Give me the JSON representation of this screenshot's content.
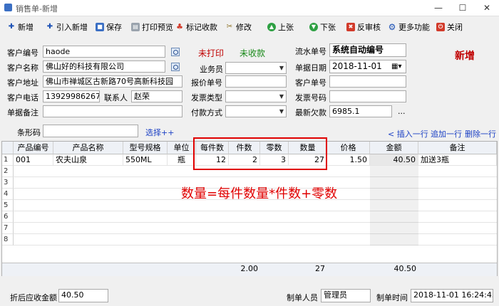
{
  "window": {
    "title": "销售单-新增",
    "min": "—",
    "max": "☐",
    "close": "✕"
  },
  "toolbar": {
    "new": "新增",
    "import_new": "引入新增",
    "save": "保存",
    "print_preview": "打印预览",
    "mark_collect": "标记收款",
    "edit": "修改",
    "prev": "上张",
    "next": "下张",
    "unapprove": "反审核",
    "more": "更多功能",
    "close": "关闭"
  },
  "form": {
    "customer_code_label": "客户编号",
    "customer_code": "haode",
    "customer_name_label": "客户名称",
    "customer_name": "佛山好的科技有限公司",
    "customer_addr_label": "客户地址",
    "customer_addr": "佛山市禅城区古新路70号高新科技园",
    "customer_phone_label": "客户电话",
    "customer_phone": "13929986267",
    "contact_label": "联系人",
    "contact": "赵荣",
    "remark_label": "单据备注",
    "remark": "",
    "print_status": "未打印",
    "collect_status": "未收款",
    "salesman_label": "业务员",
    "salesman": "",
    "quote_no_label": "报价单号",
    "quote_no": "",
    "invoice_type_label": "发票类型",
    "invoice_type": "",
    "payment_label": "付款方式",
    "payment": "",
    "serial_label": "流水单号",
    "serial": "系统自动编号",
    "date_label": "单据日期",
    "date": "2018-11-01",
    "cust_order_label": "客户单号",
    "cust_order": "",
    "invoice_no_label": "发票号码",
    "invoice_no": "",
    "debt_label": "最新欠款",
    "debt": "6985.1",
    "debt_more": "...",
    "mode_badge": "新增",
    "barcode_label": "条形码",
    "barcode": "",
    "select_link": "选择++",
    "insert_row": "< 插入一行",
    "append_row": "追加一行",
    "delete_row": "删除一行"
  },
  "grid": {
    "headers": [
      "产品编号",
      "产品名称",
      "型号规格",
      "单位",
      "每件数",
      "件数",
      "零数",
      "数量",
      "价格",
      "金额",
      "备注"
    ],
    "row_numbers": [
      "1",
      "2",
      "3",
      "4",
      "5",
      "6",
      "7",
      "8"
    ],
    "rows": [
      [
        "001",
        "农夫山泉",
        "550ML",
        "瓶",
        "12",
        "2",
        "3",
        "27",
        "1.50",
        "40.50",
        "加送3瓶"
      ]
    ],
    "footer": {
      "pieces_total": "2.00",
      "qty_total": "27",
      "amount_total": "40.50"
    }
  },
  "annotation": {
    "formula": "数量=每件数量*件数+零数",
    "color": "#e00000"
  },
  "bottom": {
    "discount_label": "折后应收金额",
    "discount_value": "40.50",
    "maker_label": "制单人员",
    "maker": "管理员",
    "time_label": "制单时间",
    "time": "2018-11-01 16:24:45"
  },
  "colors": {
    "accent_red": "#c00000",
    "status_green": "#1a8a1a",
    "link_blue": "#1a3fc4"
  }
}
